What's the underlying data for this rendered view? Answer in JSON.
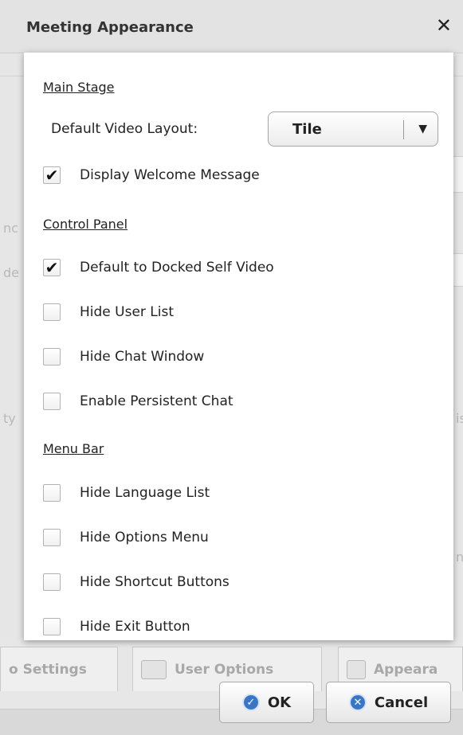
{
  "dialog": {
    "title": "Meeting Appearance",
    "close_glyph": "✕"
  },
  "background": {
    "fragments": [
      "nc",
      "de",
      "ty",
      "is",
      "n"
    ],
    "tabs": [
      {
        "label": "o Settings"
      },
      {
        "label": "User Options",
        "icon": "users-icon"
      },
      {
        "label": "Appeara",
        "icon": "appearance-icon"
      }
    ]
  },
  "panel": {
    "main_stage": {
      "heading": "Main Stage",
      "layout_label": "Default Video Layout:",
      "layout_value": "Tile",
      "welcome": {
        "label": "Display Welcome Message",
        "checked": true
      }
    },
    "control_panel": {
      "heading": "Control Panel",
      "options": [
        {
          "label": "Default to Docked Self Video",
          "checked": true
        },
        {
          "label": "Hide User List",
          "checked": false
        },
        {
          "label": "Hide Chat Window",
          "checked": false
        },
        {
          "label": "Enable Persistent Chat",
          "checked": false
        }
      ]
    },
    "menu_bar": {
      "heading": "Menu Bar",
      "options": [
        {
          "label": "Hide Language List",
          "checked": false
        },
        {
          "label": "Hide Options Menu",
          "checked": false
        },
        {
          "label": "Hide Shortcut Buttons",
          "checked": false
        },
        {
          "label": "Hide Exit Button",
          "checked": false
        }
      ]
    }
  },
  "footer": {
    "ok_label": "OK",
    "cancel_label": "Cancel"
  },
  "colors": {
    "accent": "#3a76c4"
  }
}
